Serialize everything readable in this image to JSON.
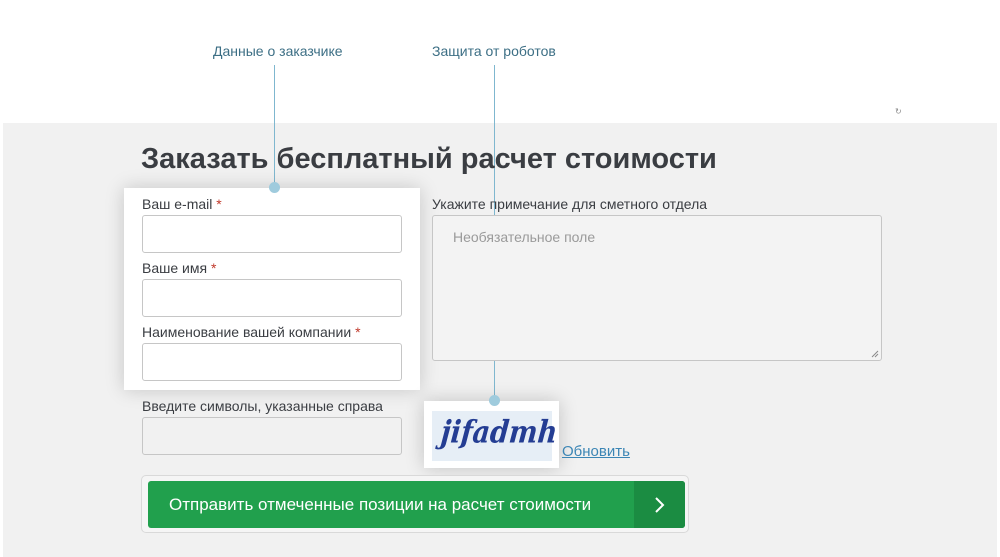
{
  "callouts": {
    "customer_data": "Данные о заказчике",
    "bot_protection": "Защита от роботов"
  },
  "form": {
    "title": "Заказать бесплатный расчет стоимости",
    "required_mark": "*",
    "email": {
      "label": "Ваш e-mail",
      "value": ""
    },
    "name": {
      "label": "Ваше имя",
      "value": ""
    },
    "company": {
      "label": "Наименование вашей компании",
      "value": ""
    },
    "note": {
      "label": "Укажите примечание для сметного отдела",
      "placeholder": "Необязательное поле"
    },
    "captcha": {
      "label": "Введите символы, указанные справа",
      "value": "",
      "image_text": "jifadmh",
      "refresh_label": "Обновить"
    },
    "submit_label": "Отправить отмеченные позиции на расчет стоимости"
  },
  "icons": {
    "submit_arrow": "chevron-right-icon",
    "resize": "resize-grip-icon"
  },
  "colors": {
    "accent_green": "#21a04d",
    "accent_green_dark": "#1b8c42",
    "callout_text": "#3d6f85",
    "link": "#3c86b5",
    "required": "#c0392b"
  }
}
